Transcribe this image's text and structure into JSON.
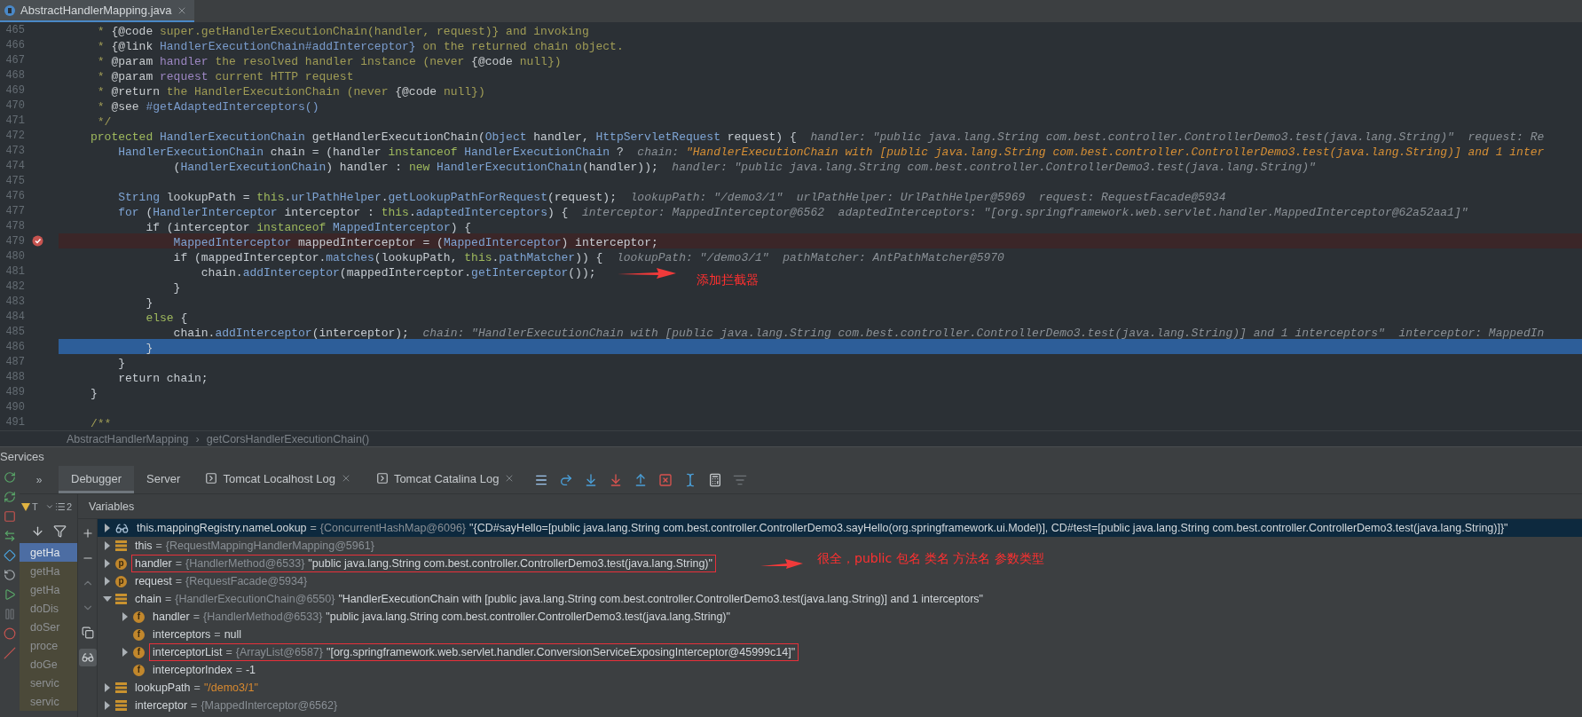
{
  "editor_tab": {
    "title": "AbstractHandlerMapping.java",
    "selected": true
  },
  "code_lines": [
    {
      "number": "465",
      "breakpoint": false,
      "selected": false,
      "segments": [
        {
          "kind": "comment",
          "text": " * "
        },
        {
          "kind": "doctag",
          "text": "{@code"
        },
        {
          "kind": "comment",
          "text": " super.getHandlerExecutionChain(handler, request)} and invoking"
        }
      ]
    },
    {
      "number": "466",
      "breakpoint": false,
      "selected": false,
      "segments": [
        {
          "kind": "comment",
          "text": " * "
        },
        {
          "kind": "doctag",
          "text": "{@link"
        },
        {
          "kind": "docref",
          "text": " HandlerExecutionChain#addInterceptor}"
        },
        {
          "kind": "comment",
          "text": " on the returned chain object."
        }
      ]
    },
    {
      "number": "467",
      "breakpoint": false,
      "selected": false,
      "segments": [
        {
          "kind": "comment",
          "text": " * "
        },
        {
          "kind": "doctag",
          "text": "@param"
        },
        {
          "kind": "docparam",
          "text": " handler"
        },
        {
          "kind": "comment",
          "text": " the resolved handler instance (never "
        },
        {
          "kind": "doctag",
          "text": "{@code"
        },
        {
          "kind": "comment",
          "text": " null})"
        }
      ]
    },
    {
      "number": "468",
      "breakpoint": false,
      "selected": false,
      "segments": [
        {
          "kind": "comment",
          "text": " * "
        },
        {
          "kind": "doctag",
          "text": "@param"
        },
        {
          "kind": "docparam",
          "text": " request"
        },
        {
          "kind": "comment",
          "text": " current HTTP request"
        }
      ]
    },
    {
      "number": "469",
      "breakpoint": false,
      "selected": false,
      "segments": [
        {
          "kind": "comment",
          "text": " * "
        },
        {
          "kind": "doctag",
          "text": "@return"
        },
        {
          "kind": "comment",
          "text": " the HandlerExecutionChain (never "
        },
        {
          "kind": "doctag",
          "text": "{@code"
        },
        {
          "kind": "comment",
          "text": " null})"
        }
      ]
    },
    {
      "number": "470",
      "breakpoint": false,
      "selected": false,
      "segments": [
        {
          "kind": "comment",
          "text": " * "
        },
        {
          "kind": "doctag",
          "text": "@see"
        },
        {
          "kind": "docref",
          "text": " #getAdaptedInterceptors()"
        }
      ]
    },
    {
      "number": "471",
      "breakpoint": false,
      "selected": false,
      "segments": [
        {
          "kind": "comment",
          "text": " */"
        }
      ]
    },
    {
      "number": "472",
      "breakpoint": false,
      "selected": false,
      "segments": [
        {
          "kind": "keyword",
          "text": "protected "
        },
        {
          "kind": "type",
          "text": "HandlerExecutionChain"
        },
        {
          "kind": "plain",
          "text": " getHandlerExecutionChain("
        },
        {
          "kind": "type",
          "text": "Object"
        },
        {
          "kind": "plain",
          "text": " handler, "
        },
        {
          "kind": "type",
          "text": "HttpServletRequest"
        },
        {
          "kind": "plain",
          "text": " request) {"
        },
        {
          "kind": "hint",
          "text": "  handler: \"public java.lang.String com.best.controller.ControllerDemo3.test(java.lang.String)\"  request: Re"
        }
      ]
    },
    {
      "number": "473",
      "breakpoint": false,
      "selected": false,
      "segments": [
        {
          "kind": "type",
          "text": "    HandlerExecutionChain"
        },
        {
          "kind": "plain",
          "text": " chain = (handler "
        },
        {
          "kind": "keyword",
          "text": "instanceof "
        },
        {
          "kind": "type",
          "text": "HandlerExecutionChain"
        },
        {
          "kind": "plain",
          "text": " ?"
        },
        {
          "kind": "hint",
          "text": "  chain: "
        },
        {
          "kind": "hint_changed",
          "text": "\"HandlerExecutionChain with [public java.lang.String com.best.controller.ControllerDemo3.test(java.lang.String)] and 1 inter"
        }
      ]
    },
    {
      "number": "474",
      "breakpoint": false,
      "selected": false,
      "segments": [
        {
          "kind": "plain",
          "text": "            ("
        },
        {
          "kind": "type",
          "text": "HandlerExecutionChain"
        },
        {
          "kind": "plain",
          "text": ") handler : "
        },
        {
          "kind": "keyword",
          "text": "new "
        },
        {
          "kind": "type",
          "text": "HandlerExecutionChain"
        },
        {
          "kind": "plain",
          "text": "(handler));"
        },
        {
          "kind": "hint",
          "text": "  handler: \"public java.lang.String com.best.controller.ControllerDemo3.test(java.lang.String)\""
        }
      ]
    },
    {
      "number": "475",
      "breakpoint": false,
      "selected": false
    },
    {
      "number": "476",
      "breakpoint": false,
      "selected": false,
      "segments": [
        {
          "kind": "type",
          "text": "    String"
        },
        {
          "kind": "plain",
          "text": " lookupPath = "
        },
        {
          "kind": "keyword",
          "text": "this"
        },
        {
          "kind": "plain",
          "text": "."
        },
        {
          "kind": "type",
          "text": "urlPathHelper"
        },
        {
          "kind": "plain",
          "text": "."
        },
        {
          "kind": "type",
          "text": "getLookupPathForRequest"
        },
        {
          "kind": "plain",
          "text": "(request);"
        },
        {
          "kind": "hint",
          "text": "  lookupPath: \"/demo3/1\"  urlPathHelper: UrlPathHelper@5969  request: RequestFacade@5934"
        }
      ]
    },
    {
      "number": "477",
      "breakpoint": false,
      "selected": false,
      "segments": [
        {
          "kind": "type",
          "text": "    for"
        },
        {
          "kind": "plain",
          "text": " ("
        },
        {
          "kind": "type",
          "text": "HandlerInterceptor"
        },
        {
          "kind": "plain",
          "text": " interceptor : "
        },
        {
          "kind": "keyword",
          "text": "this"
        },
        {
          "kind": "plain",
          "text": "."
        },
        {
          "kind": "type",
          "text": "adaptedInterceptors"
        },
        {
          "kind": "plain",
          "text": ") {"
        },
        {
          "kind": "hint",
          "text": "  interceptor: MappedInterceptor@6562  adaptedInterceptors: \"[org.springframework.web.servlet.handler.MappedInterceptor@62a52aa1]\""
        }
      ]
    },
    {
      "number": "478",
      "breakpoint": false,
      "selected": false,
      "segments": [
        {
          "kind": "plain",
          "text": "        if (interceptor "
        },
        {
          "kind": "keyword",
          "text": "instanceof "
        },
        {
          "kind": "type",
          "text": "MappedInterceptor"
        },
        {
          "kind": "plain",
          "text": ") {"
        }
      ]
    },
    {
      "number": "479",
      "breakpoint": true,
      "selected": false,
      "segments": [
        {
          "kind": "type",
          "text": "            MappedInterceptor"
        },
        {
          "kind": "plain",
          "text": " mappedInterceptor = ("
        },
        {
          "kind": "type",
          "text": "MappedInterceptor"
        },
        {
          "kind": "plain",
          "text": ") interceptor;"
        }
      ]
    },
    {
      "number": "480",
      "breakpoint": false,
      "selected": false,
      "segments": [
        {
          "kind": "plain",
          "text": "            if (mappedInterceptor."
        },
        {
          "kind": "type",
          "text": "matches"
        },
        {
          "kind": "plain",
          "text": "(lookupPath, "
        },
        {
          "kind": "keyword",
          "text": "this"
        },
        {
          "kind": "plain",
          "text": "."
        },
        {
          "kind": "type",
          "text": "pathMatcher"
        },
        {
          "kind": "plain",
          "text": ")) {"
        },
        {
          "kind": "hint",
          "text": "  lookupPath: \"/demo3/1\"  pathMatcher: AntPathMatcher@5970"
        }
      ]
    },
    {
      "number": "481",
      "breakpoint": false,
      "selected": false,
      "segments": [
        {
          "kind": "plain",
          "text": "                chain."
        },
        {
          "kind": "type",
          "text": "addInterceptor"
        },
        {
          "kind": "plain",
          "text": "(mappedInterceptor."
        },
        {
          "kind": "type",
          "text": "getInterceptor"
        },
        {
          "kind": "plain",
          "text": "());"
        }
      ]
    },
    {
      "number": "482",
      "breakpoint": false,
      "selected": false,
      "segments": [
        {
          "kind": "plain",
          "text": "            }"
        }
      ]
    },
    {
      "number": "483",
      "breakpoint": false,
      "selected": false,
      "segments": [
        {
          "kind": "plain",
          "text": "        }"
        }
      ]
    },
    {
      "number": "484",
      "breakpoint": false,
      "selected": false,
      "segments": [
        {
          "kind": "keyword",
          "text": "        else"
        },
        {
          "kind": "plain",
          "text": " {"
        }
      ]
    },
    {
      "number": "485",
      "breakpoint": false,
      "selected": false,
      "segments": [
        {
          "kind": "plain",
          "text": "            chain."
        },
        {
          "kind": "type",
          "text": "addInterceptor"
        },
        {
          "kind": "plain",
          "text": "(interceptor);"
        },
        {
          "kind": "hint",
          "text": "  chain: \"HandlerExecutionChain with [public java.lang.String com.best.controller.ControllerDemo3.test(java.lang.String)] and 1 interceptors\"  interceptor: MappedIn"
        }
      ]
    },
    {
      "number": "486",
      "breakpoint": false,
      "selected": true,
      "segments": [
        {
          "kind": "plain",
          "text": "        }"
        }
      ]
    },
    {
      "number": "487",
      "breakpoint": false,
      "selected": false,
      "segments": [
        {
          "kind": "plain",
          "text": "    }"
        }
      ]
    },
    {
      "number": "488",
      "breakpoint": false,
      "selected": false,
      "segments": [
        {
          "kind": "plain",
          "text": "    return chain;"
        }
      ]
    },
    {
      "number": "489",
      "breakpoint": false,
      "selected": false,
      "segments": [
        {
          "kind": "plain",
          "text": "}"
        }
      ]
    },
    {
      "number": "490",
      "breakpoint": false,
      "selected": false
    },
    {
      "number": "491",
      "breakpoint": false,
      "selected": false,
      "segments": [
        {
          "kind": "comment",
          "text": "/**"
        }
      ]
    }
  ],
  "breadcrumb": {
    "items": [
      "AbstractHandlerMapping",
      "getCorsHandlerExecutionChain()"
    ],
    "separator": "›"
  },
  "services": {
    "title": "Services"
  },
  "debugger": {
    "overflow": "»",
    "tabs": [
      {
        "label": "Debugger",
        "selected": true,
        "kind": "plain"
      },
      {
        "label": "Server",
        "selected": false,
        "kind": "plain"
      },
      {
        "label": "Tomcat Localhost Log",
        "selected": false,
        "kind": "log"
      },
      {
        "label": "Tomcat Catalina Log",
        "selected": false,
        "kind": "log"
      }
    ]
  },
  "frames": {
    "thread": "T",
    "count": "2",
    "items": [
      {
        "label": "getHa",
        "selected": true
      },
      {
        "label": "getHa",
        "selected": false
      },
      {
        "label": "getHa",
        "selected": false
      },
      {
        "label": "doDis",
        "selected": false
      },
      {
        "label": "doSer",
        "selected": false
      },
      {
        "label": "proce",
        "selected": false
      },
      {
        "label": "doGe",
        "selected": false
      },
      {
        "label": "servic",
        "selected": false
      },
      {
        "label": "servic",
        "selected": false
      }
    ]
  },
  "variables": {
    "title": "Variables",
    "rows": [
      {
        "kind": "watch",
        "has_children": true,
        "expanded": false,
        "selected": true,
        "annotated": false,
        "name": "this.mappingRegistry.nameLookup",
        "equals": "=",
        "type": "{ConcurrentHashMap@6096}",
        "value": "\"{CD#sayHello=[public java.lang.String com.best.controller.ControllerDemo3.sayHello(org.springframework.ui.Model)], CD#test=[public java.lang.String com.best.controller.ControllerDemo3.test(java.lang.String)]}\"",
        "is_string": false
      },
      {
        "kind": "object",
        "has_children": true,
        "expanded": false,
        "selected": false,
        "annotated": false,
        "name": "this",
        "equals": "=",
        "type": "{RequestMappingHandlerMapping@5961}"
      },
      {
        "kind": "badge",
        "badge": "p",
        "has_children": true,
        "expanded": false,
        "selected": false,
        "annotated": true,
        "name": "handler",
        "equals": "=",
        "type": "{HandlerMethod@6533}",
        "value": "\"public java.lang.String com.best.controller.ControllerDemo3.test(java.lang.String)\"",
        "is_string": false
      },
      {
        "kind": "badge",
        "badge": "p",
        "has_children": true,
        "expanded": false,
        "selected": false,
        "annotated": false,
        "name": "request",
        "equals": "=",
        "type": "{RequestFacade@5934}"
      },
      {
        "kind": "object",
        "has_children": true,
        "expanded": true,
        "selected": false,
        "annotated": false,
        "name": "chain",
        "equals": "=",
        "type": "{HandlerExecutionChain@6550}",
        "value": "\"HandlerExecutionChain with [public java.lang.String com.best.controller.ControllerDemo3.test(java.lang.String)] and 1 interceptors\"",
        "is_string": false,
        "children": [
          {
            "kind": "badge",
            "badge": "f",
            "has_children": true,
            "expanded": false,
            "selected": false,
            "annotated": false,
            "name": "handler",
            "equals": "=",
            "type": "{HandlerMethod@6533}",
            "value": "\"public java.lang.String com.best.controller.ControllerDemo3.test(java.lang.String)\"",
            "is_string": false
          },
          {
            "kind": "badge",
            "badge": "f",
            "selected": false,
            "annotated": false,
            "name": "interceptors",
            "equals": "=",
            "value": "null",
            "is_string": false
          },
          {
            "kind": "badge",
            "badge": "f",
            "has_children": true,
            "expanded": false,
            "selected": false,
            "annotated": true,
            "name": "interceptorList",
            "equals": "=",
            "type": "{ArrayList@6587}",
            "value": "\"[org.springframework.web.servlet.handler.ConversionServiceExposingInterceptor@45999c14]\"",
            "is_string": false
          },
          {
            "kind": "badge",
            "badge": "f",
            "selected": false,
            "annotated": false,
            "name": "interceptorIndex",
            "equals": "=",
            "value": "-1",
            "is_string": false
          }
        ]
      },
      {
        "kind": "object",
        "has_children": true,
        "expanded": false,
        "selected": false,
        "annotated": false,
        "name": "lookupPath",
        "equals": "=",
        "value": "\"/demo3/1\"",
        "is_string": true
      },
      {
        "kind": "object",
        "has_children": true,
        "expanded": false,
        "selected": false,
        "annotated": false,
        "name": "interceptor",
        "equals": "=",
        "type": "{MappedInterceptor@6562}"
      }
    ]
  },
  "annotations": [
    {
      "text": "添加拦截器"
    },
    {
      "text": "很全，public 包名 类名 方法名 参数类型"
    }
  ]
}
